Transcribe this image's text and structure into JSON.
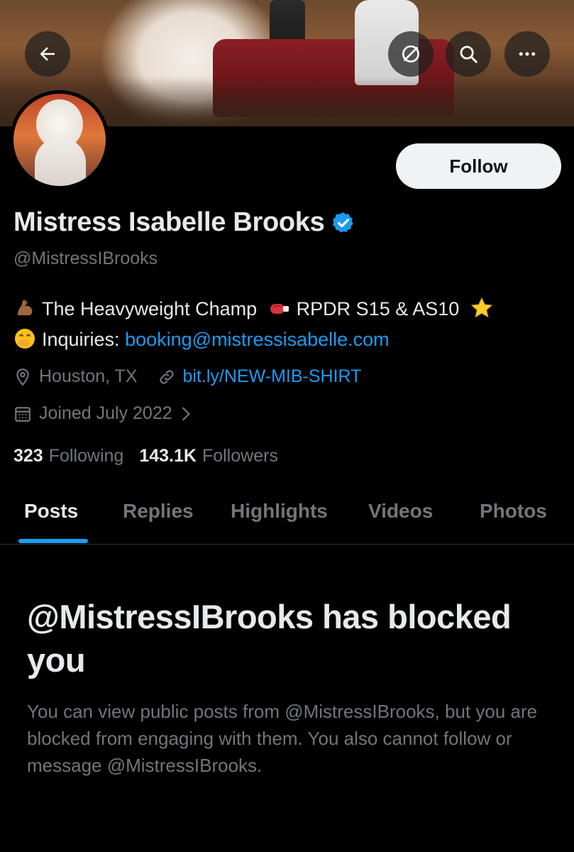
{
  "header": {
    "back_icon": "arrow-left-icon",
    "actions": [
      {
        "icon": "grok-icon"
      },
      {
        "icon": "search-icon"
      },
      {
        "icon": "more-icon"
      }
    ]
  },
  "profile": {
    "display_name": "Mistress Isabelle Brooks",
    "verified": true,
    "handle": "@MistressIBrooks",
    "follow_label": "Follow",
    "bio": {
      "line1_text_a": "The Heavyweight Champ",
      "line1_text_b": "RPDR S15 & AS10",
      "line2_label": "Inquiries:",
      "line2_link": "booking@mistressisabelle.com"
    },
    "location": "Houston, TX",
    "website": "bit.ly/NEW-MIB-SHIRT",
    "joined": "Joined July 2022",
    "following_count": "323",
    "following_label": "Following",
    "followers_count": "143.1K",
    "followers_label": "Followers"
  },
  "tabs": [
    {
      "label": "Posts",
      "active": true
    },
    {
      "label": "Replies",
      "active": false
    },
    {
      "label": "Highlights",
      "active": false
    },
    {
      "label": "Videos",
      "active": false
    },
    {
      "label": "Photos",
      "active": false
    }
  ],
  "blocked": {
    "title": "@MistressIBrooks has blocked you",
    "description": "You can view public posts from @MistressIBrooks, but you are blocked from engaging with them. You also cannot follow or message @MistressIBrooks."
  },
  "colors": {
    "background": "#000000",
    "text_primary": "#e7e9ea",
    "text_secondary": "#71767b",
    "accent": "#1d9bf0"
  }
}
